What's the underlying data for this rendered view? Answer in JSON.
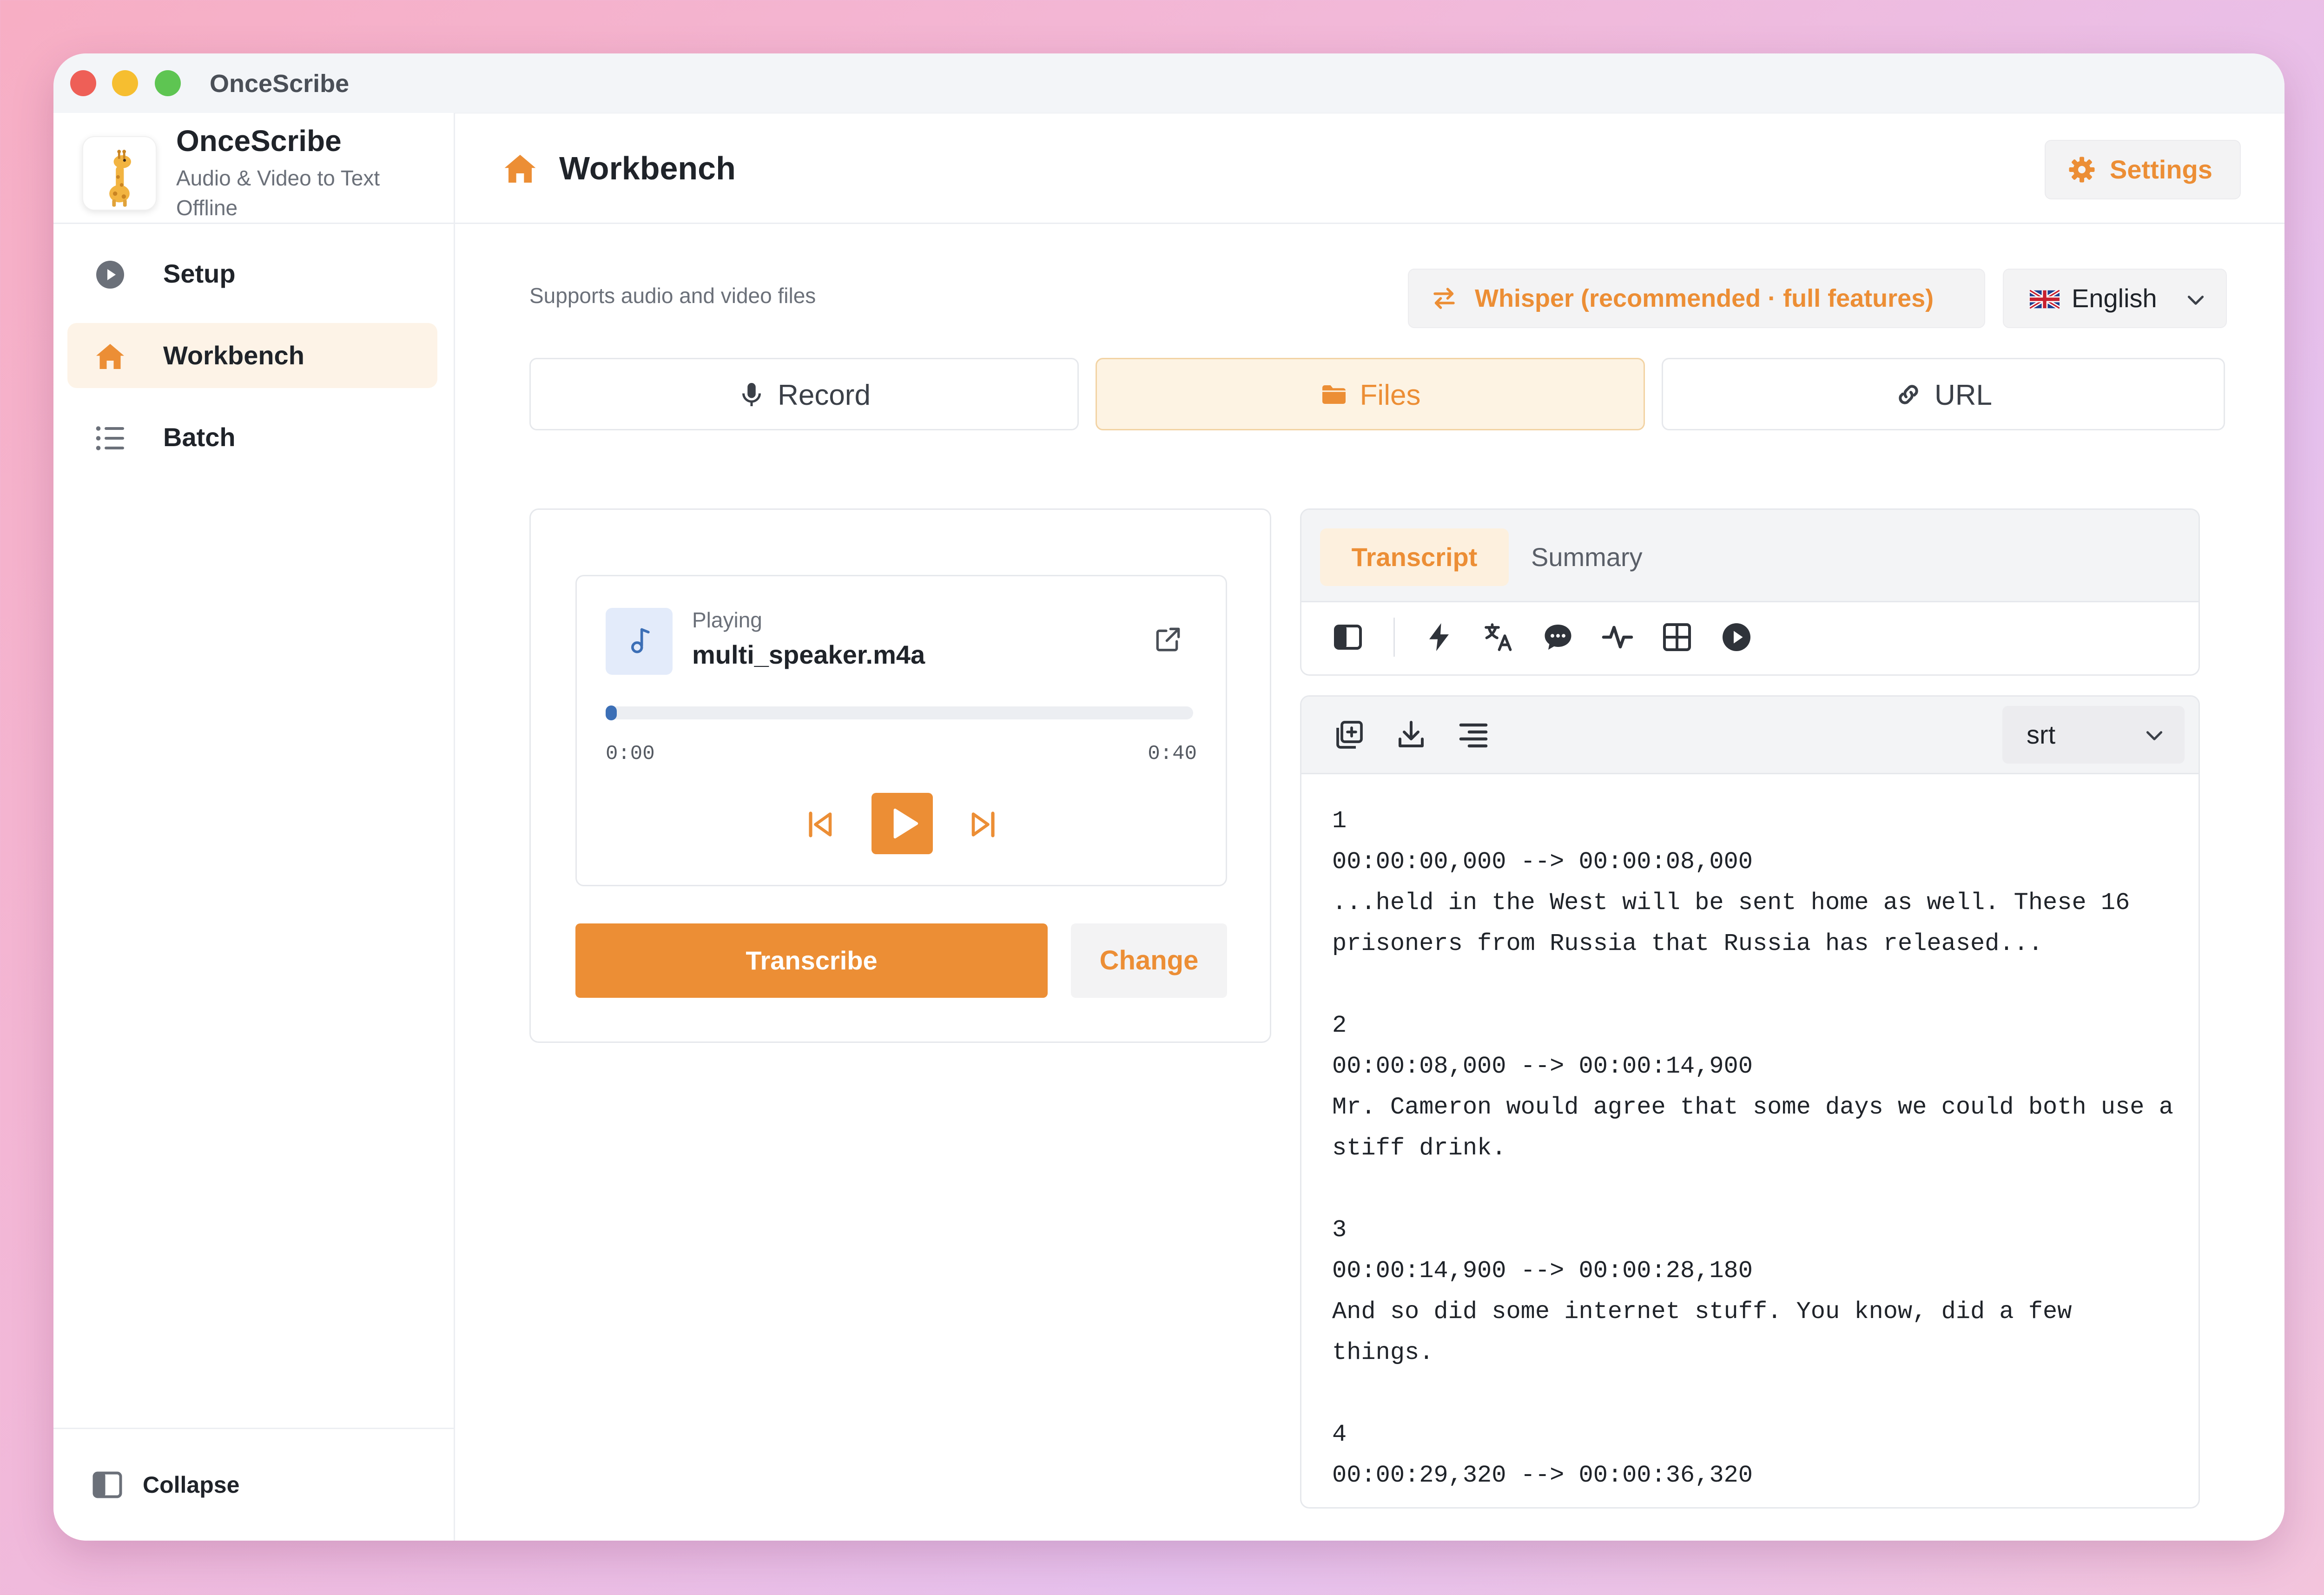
{
  "window": {
    "title": "OnceScribe"
  },
  "brand": {
    "name": "OnceScribe",
    "subtitle": "Audio & Video to Text Offline",
    "logo": "giraffe-logo"
  },
  "sidebar": {
    "items": [
      {
        "label": "Setup",
        "icon": "play-circle-icon",
        "active": false
      },
      {
        "label": "Workbench",
        "icon": "home-icon",
        "active": true
      },
      {
        "label": "Batch",
        "icon": "list-icon",
        "active": false
      }
    ],
    "collapse_label": "Collapse"
  },
  "header": {
    "title": "Workbench",
    "settings_label": "Settings"
  },
  "main": {
    "supports_text": "Supports audio and video files",
    "model_label": "Whisper (recommended · full features)",
    "language": {
      "flag": "uk-flag",
      "selected": "English"
    },
    "modes": [
      {
        "label": "Record",
        "icon": "microphone-icon",
        "active": false
      },
      {
        "label": "Files",
        "icon": "folder-icon",
        "active": true
      },
      {
        "label": "URL",
        "icon": "link-icon",
        "active": false
      }
    ]
  },
  "player": {
    "status": "Playing",
    "file_name": "multi_speaker.m4a",
    "current_time": "0:00",
    "duration": "0:40",
    "progress": 0.0
  },
  "actions": {
    "transcribe_label": "Transcribe",
    "change_label": "Change"
  },
  "output": {
    "tabs": [
      {
        "label": "Transcript",
        "active": true
      },
      {
        "label": "Summary",
        "active": false
      }
    ],
    "format": "srt",
    "transcript": "1\n00:00:00,000 --> 00:00:08,000\n...held in the West will be sent home as well. These 16 prisoners from Russia that Russia has released...\n\n2\n00:00:08,000 --> 00:00:14,900\nMr. Cameron would agree that some days we could both use a stiff drink.\n\n3\n00:00:14,900 --> 00:00:28,180\nAnd so did some internet stuff. You know, did a few things.\n\n4\n00:00:29,320 --> 00:00:36,320"
  },
  "colors": {
    "accent": "#ec8e35",
    "accent_soft": "#fdf3e3",
    "progress": "#3c6fb6"
  }
}
